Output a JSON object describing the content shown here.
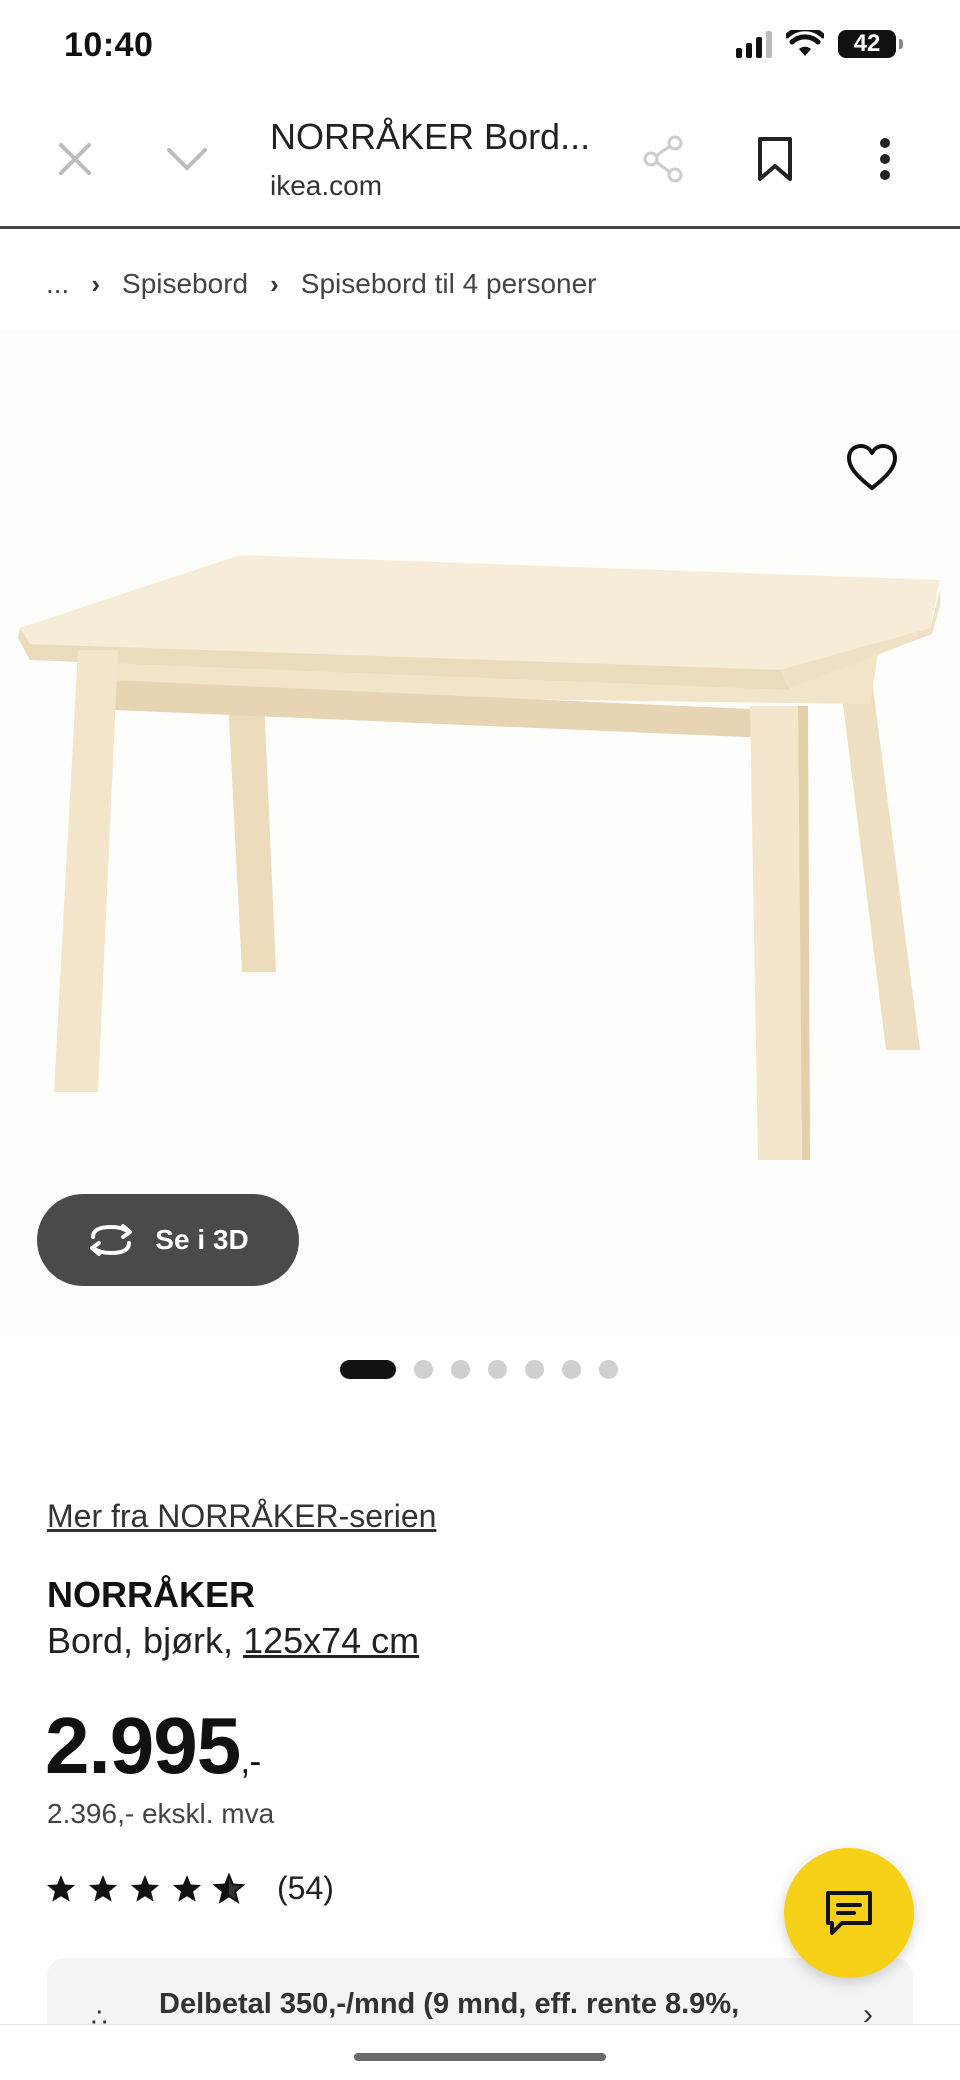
{
  "status_bar": {
    "time": "10:40",
    "battery": "42"
  },
  "browser": {
    "title": "NORRÅKER Bord...",
    "url": "ikea.com",
    "icons": [
      "close-icon",
      "chevron-down-icon",
      "share-icon",
      "bookmark-icon",
      "more-icon"
    ]
  },
  "breadcrumb": {
    "ellipsis": "...",
    "items": [
      "Spisebord",
      "Spisebord til 4 personer"
    ]
  },
  "hero": {
    "favorite_icon": "heart-icon",
    "view_3d_label": "Se i 3D",
    "view_3d_icon": "rotate-icon",
    "carousel_count": 7,
    "carousel_active": 0
  },
  "product": {
    "series_link": "Mer fra NORRÅKER-serien",
    "name": "NORRÅKER",
    "description_prefix": "Bord, bjørk, ",
    "size_link": "125x74 cm",
    "price_main": "2.995",
    "price_suffix": ",-",
    "price_ex_vat": "2.396,- ekskl. mva",
    "rating_stars": 4.5,
    "rating_count": "(54)"
  },
  "installment": {
    "text": "Delbetal 350,-/mnd (9 mnd, eff. rente 8.9%,",
    "icon": "spinner-icon"
  },
  "chat": {
    "icon": "chat-icon"
  },
  "colors": {
    "ikea_yellow": "#f7d117",
    "dark_button": "#4a4a4a",
    "wood_light": "#f3e6cc"
  }
}
